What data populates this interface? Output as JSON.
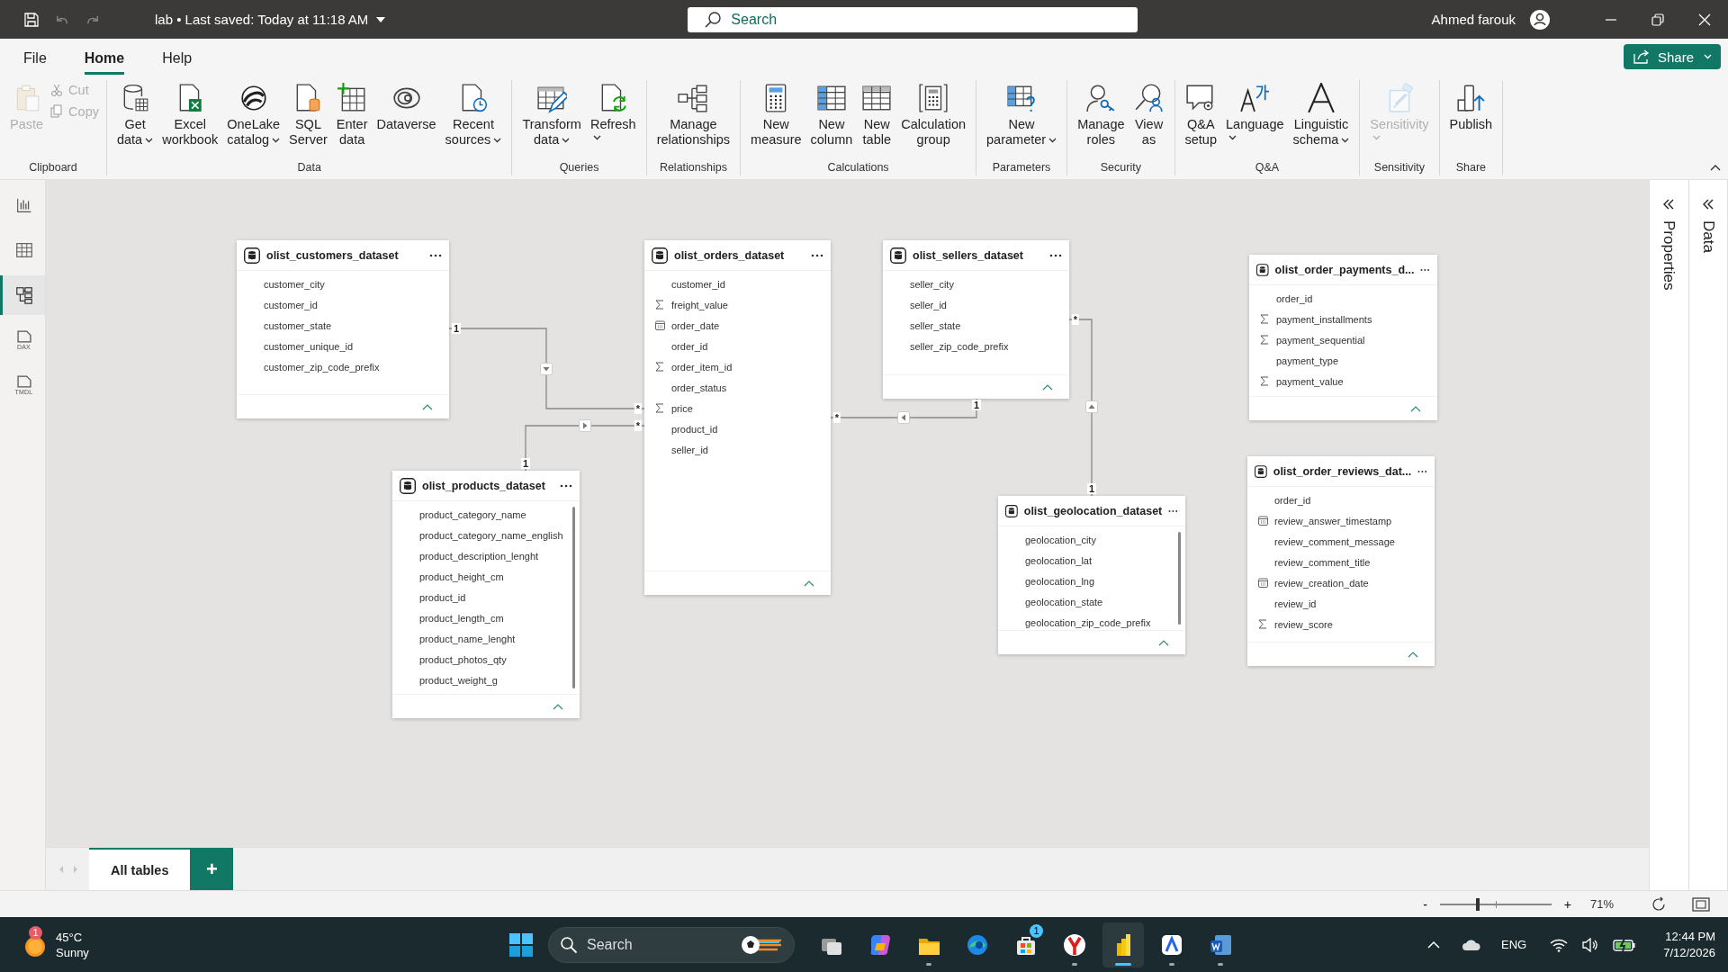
{
  "titlebar": {
    "title": "lab • Last saved: Today at 11:18 AM",
    "search": {
      "placeholder": "Search"
    },
    "user": "Ahmed farouk"
  },
  "menu": [
    {
      "label": "File",
      "selected": false
    },
    {
      "label": "Home",
      "selected": true
    },
    {
      "label": "Help",
      "selected": false
    }
  ],
  "share_button": "Share",
  "ribbon": {
    "groups": [
      {
        "label": "Clipboard",
        "buttons": [
          {
            "label": "Paste",
            "kind": "large",
            "disabled": true,
            "dropdown": false
          },
          {
            "label": "Cut",
            "kind": "small",
            "disabled": true,
            "dropdown": false
          },
          {
            "label": "Copy",
            "kind": "small",
            "disabled": true,
            "dropdown": false
          }
        ]
      },
      {
        "label": "Data",
        "buttons": [
          {
            "label": "Get\ndata",
            "kind": "large",
            "disabled": false,
            "dropdown": true
          },
          {
            "label": "Excel\nworkbook",
            "kind": "large",
            "disabled": false,
            "dropdown": false
          },
          {
            "label": "OneLake\ncatalog",
            "kind": "large",
            "disabled": false,
            "dropdown": true
          },
          {
            "label": "SQL\nServer",
            "kind": "large",
            "disabled": false,
            "dropdown": false
          },
          {
            "label": "Enter\ndata",
            "kind": "large",
            "disabled": false,
            "dropdown": false
          },
          {
            "label": "Dataverse",
            "kind": "large",
            "disabled": false,
            "dropdown": false
          },
          {
            "label": "Recent\nsources",
            "kind": "large",
            "disabled": false,
            "dropdown": true
          }
        ]
      },
      {
        "label": "Queries",
        "buttons": [
          {
            "label": "Transform\ndata",
            "kind": "large",
            "disabled": false,
            "dropdown": true
          },
          {
            "label": "Refresh",
            "kind": "split",
            "disabled": false,
            "dropdown": true
          }
        ]
      },
      {
        "label": "Relationships",
        "buttons": [
          {
            "label": "Manage\nrelationships",
            "kind": "large",
            "disabled": false,
            "dropdown": false
          }
        ]
      },
      {
        "label": "Calculations",
        "buttons": [
          {
            "label": "New\nmeasure",
            "kind": "large",
            "disabled": false,
            "dropdown": false
          },
          {
            "label": "New\ncolumn",
            "kind": "large",
            "disabled": false,
            "dropdown": false
          },
          {
            "label": "New\ntable",
            "kind": "large",
            "disabled": false,
            "dropdown": false
          },
          {
            "label": "Calculation\ngroup",
            "kind": "large",
            "disabled": false,
            "dropdown": false
          }
        ]
      },
      {
        "label": "Parameters",
        "buttons": [
          {
            "label": "New\nparameter",
            "kind": "large",
            "disabled": false,
            "dropdown": true
          }
        ]
      },
      {
        "label": "Security",
        "buttons": [
          {
            "label": "Manage\nroles",
            "kind": "large",
            "disabled": false,
            "dropdown": false
          },
          {
            "label": "View\nas",
            "kind": "large",
            "disabled": false,
            "dropdown": false
          }
        ]
      },
      {
        "label": "Q&A",
        "buttons": [
          {
            "label": "Q&A\nsetup",
            "kind": "large",
            "disabled": false,
            "dropdown": false
          },
          {
            "label": "Language",
            "kind": "split",
            "disabled": false,
            "dropdown": true
          },
          {
            "label": "Linguistic\nschema",
            "kind": "large",
            "disabled": false,
            "dropdown": true
          }
        ]
      },
      {
        "label": "Sensitivity",
        "buttons": [
          {
            "label": "Sensitivity",
            "kind": "split",
            "disabled": true,
            "dropdown": true
          }
        ]
      },
      {
        "label": "Share",
        "buttons": [
          {
            "label": "Publish",
            "kind": "large",
            "disabled": false,
            "dropdown": false
          }
        ]
      }
    ]
  },
  "rail": [
    {
      "kind": "report",
      "selected": false
    },
    {
      "kind": "table",
      "selected": false
    },
    {
      "kind": "model",
      "selected": true
    },
    {
      "kind": "dax",
      "label": "DAX",
      "selected": false
    },
    {
      "kind": "tmdl",
      "label": "TMDL",
      "selected": false
    }
  ],
  "tables": [
    {
      "name": "olist_customers_dataset",
      "fields": [
        {
          "name": "customer_city",
          "kind": "text"
        },
        {
          "name": "customer_id",
          "kind": "text"
        },
        {
          "name": "customer_state",
          "kind": "text"
        },
        {
          "name": "customer_unique_id",
          "kind": "text"
        },
        {
          "name": "customer_zip_code_prefix",
          "kind": "text"
        }
      ]
    },
    {
      "name": "olist_orders_dataset",
      "fields": [
        {
          "name": "customer_id",
          "kind": "text"
        },
        {
          "name": "freight_value",
          "kind": "sum"
        },
        {
          "name": "order_date",
          "kind": "date"
        },
        {
          "name": "order_id",
          "kind": "text"
        },
        {
          "name": "order_item_id",
          "kind": "sum"
        },
        {
          "name": "order_status",
          "kind": "text"
        },
        {
          "name": "price",
          "kind": "sum"
        },
        {
          "name": "product_id",
          "kind": "text"
        },
        {
          "name": "seller_id",
          "kind": "text"
        }
      ]
    },
    {
      "name": "olist_sellers_dataset",
      "fields": [
        {
          "name": "seller_city",
          "kind": "text"
        },
        {
          "name": "seller_id",
          "kind": "text"
        },
        {
          "name": "seller_state",
          "kind": "text"
        },
        {
          "name": "seller_zip_code_prefix",
          "kind": "text"
        }
      ]
    },
    {
      "name": "olist_order_payments_d...",
      "fields": [
        {
          "name": "order_id",
          "kind": "text"
        },
        {
          "name": "payment_installments",
          "kind": "sum"
        },
        {
          "name": "payment_sequential",
          "kind": "sum"
        },
        {
          "name": "payment_type",
          "kind": "text"
        },
        {
          "name": "payment_value",
          "kind": "sum"
        }
      ]
    },
    {
      "name": "olist_products_dataset",
      "fields": [
        {
          "name": "product_category_name",
          "kind": "text"
        },
        {
          "name": "product_category_name_english",
          "kind": "text"
        },
        {
          "name": "product_description_lenght",
          "kind": "text"
        },
        {
          "name": "product_height_cm",
          "kind": "text"
        },
        {
          "name": "product_id",
          "kind": "text"
        },
        {
          "name": "product_length_cm",
          "kind": "text"
        },
        {
          "name": "product_name_lenght",
          "kind": "text"
        },
        {
          "name": "product_photos_qty",
          "kind": "text"
        },
        {
          "name": "product_weight_g",
          "kind": "text"
        }
      ]
    },
    {
      "name": "olist_geolocation_dataset",
      "fields": [
        {
          "name": "geolocation_city",
          "kind": "text"
        },
        {
          "name": "geolocation_lat",
          "kind": "text"
        },
        {
          "name": "geolocation_lng",
          "kind": "text"
        },
        {
          "name": "geolocation_state",
          "kind": "text"
        },
        {
          "name": "geolocation_zip_code_prefix",
          "kind": "text"
        }
      ]
    },
    {
      "name": "olist_order_reviews_dat...",
      "fields": [
        {
          "name": "order_id",
          "kind": "text"
        },
        {
          "name": "review_answer_timestamp",
          "kind": "date"
        },
        {
          "name": "review_comment_message",
          "kind": "text"
        },
        {
          "name": "review_comment_title",
          "kind": "text"
        },
        {
          "name": "review_creation_date",
          "kind": "date"
        },
        {
          "name": "review_id",
          "kind": "text"
        },
        {
          "name": "review_score",
          "kind": "sum"
        }
      ]
    }
  ],
  "relationships": [
    {
      "start_label": "1",
      "end_label": "*",
      "kind": "down"
    },
    {
      "start_label": "1",
      "end_label": "*",
      "kind": "right"
    },
    {
      "start_label": "*",
      "end_label": "1",
      "kind": "left"
    },
    {
      "start_label": "*",
      "end_label": "1",
      "kind": "up"
    }
  ],
  "panes": [
    {
      "label": "Properties"
    },
    {
      "label": "Data"
    }
  ],
  "pages": {
    "tabs": [
      {
        "label": "All tables",
        "selected": true
      }
    ],
    "add_button": "+"
  },
  "status": {
    "zoom": {
      "minus": "-",
      "plus": "+",
      "level": 0.34,
      "reading": "71%"
    }
  },
  "taskbar": {
    "weather": {
      "badge": "1",
      "temperature": "45°C",
      "condition": "Sunny"
    },
    "search": {
      "placeholder": "Search"
    },
    "apps": [
      {
        "running": false,
        "active": false
      },
      {
        "running": false,
        "active": false
      },
      {
        "running": true,
        "active": false
      },
      {
        "running": false,
        "active": false
      },
      {
        "running": false,
        "active": false,
        "badge": "1"
      },
      {
        "running": true,
        "active": false
      },
      {
        "running": true,
        "active": true
      },
      {
        "running": true,
        "active": false
      },
      {
        "running": true,
        "active": false
      }
    ],
    "language": "ENG",
    "time": "12:44 PM",
    "date": "7/12/2026"
  }
}
